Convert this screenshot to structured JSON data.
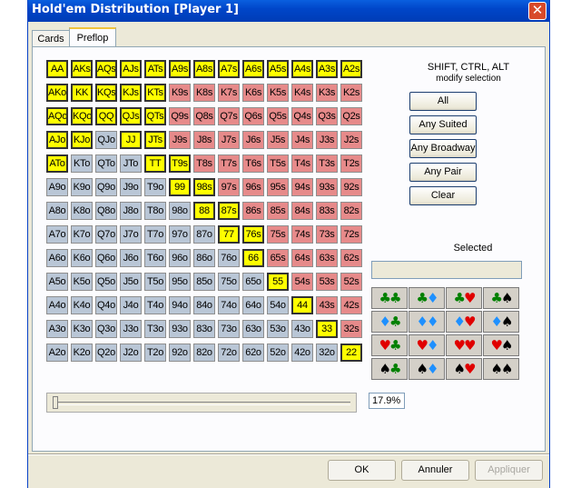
{
  "window": {
    "title": "Hold'em Distribution [Player 1]",
    "close_glyph": "✕"
  },
  "tabs": [
    {
      "label": "Cards"
    },
    {
      "label": "Preflop"
    }
  ],
  "grid": {
    "rows": [
      [
        "AA",
        "AKs",
        "AQs",
        "AJs",
        "ATs",
        "A9s",
        "A8s",
        "A7s",
        "A6s",
        "A5s",
        "A4s",
        "A3s",
        "A2s"
      ],
      [
        "AKo",
        "KK",
        "KQs",
        "KJs",
        "KTs",
        "K9s",
        "K8s",
        "K7s",
        "K6s",
        "K5s",
        "K4s",
        "K3s",
        "K2s"
      ],
      [
        "AQo",
        "KQo",
        "QQ",
        "QJs",
        "QTs",
        "Q9s",
        "Q8s",
        "Q7s",
        "Q6s",
        "Q5s",
        "Q4s",
        "Q3s",
        "Q2s"
      ],
      [
        "AJo",
        "KJo",
        "QJo",
        "JJ",
        "JTs",
        "J9s",
        "J8s",
        "J7s",
        "J6s",
        "J5s",
        "J4s",
        "J3s",
        "J2s"
      ],
      [
        "ATo",
        "KTo",
        "QTo",
        "JTo",
        "TT",
        "T9s",
        "T8s",
        "T7s",
        "T6s",
        "T5s",
        "T4s",
        "T3s",
        "T2s"
      ],
      [
        "A9o",
        "K9o",
        "Q9o",
        "J9o",
        "T9o",
        "99",
        "98s",
        "97s",
        "96s",
        "95s",
        "94s",
        "93s",
        "92s"
      ],
      [
        "A8o",
        "K8o",
        "Q8o",
        "J8o",
        "T8o",
        "98o",
        "88",
        "87s",
        "86s",
        "85s",
        "84s",
        "83s",
        "82s"
      ],
      [
        "A7o",
        "K7o",
        "Q7o",
        "J7o",
        "T7o",
        "97o",
        "87o",
        "77",
        "76s",
        "75s",
        "74s",
        "73s",
        "72s"
      ],
      [
        "A6o",
        "K6o",
        "Q6o",
        "J6o",
        "T6o",
        "96o",
        "86o",
        "76o",
        "66",
        "65s",
        "64s",
        "63s",
        "62s"
      ],
      [
        "A5o",
        "K5o",
        "Q5o",
        "J5o",
        "T5o",
        "95o",
        "85o",
        "75o",
        "65o",
        "55",
        "54s",
        "53s",
        "52s"
      ],
      [
        "A4o",
        "K4o",
        "Q4o",
        "J4o",
        "T4o",
        "94o",
        "84o",
        "74o",
        "64o",
        "54o",
        "44",
        "43s",
        "42s"
      ],
      [
        "A3o",
        "K3o",
        "Q3o",
        "J3o",
        "T3o",
        "93o",
        "83o",
        "73o",
        "63o",
        "53o",
        "43o",
        "33",
        "32s"
      ],
      [
        "A2o",
        "K2o",
        "Q2o",
        "J2o",
        "T2o",
        "92o",
        "82o",
        "72o",
        "62o",
        "52o",
        "42o",
        "32o",
        "22"
      ]
    ],
    "selected": [
      "AA",
      "AKs",
      "AQs",
      "AJs",
      "ATs",
      "A9s",
      "A8s",
      "A7s",
      "A6s",
      "A5s",
      "A4s",
      "A3s",
      "A2s",
      "AKo",
      "KK",
      "KQs",
      "KJs",
      "KTs",
      "AQo",
      "KQo",
      "QQ",
      "QJs",
      "QTs",
      "AJo",
      "KJo",
      "JJ",
      "JTs",
      "ATo",
      "TT",
      "T9s",
      "99",
      "98s",
      "88",
      "87s",
      "77",
      "76s",
      "66",
      "55",
      "44",
      "33",
      "22"
    ],
    "colors": {
      "selected": "#ffff00",
      "suited": "#e68a8a",
      "offsuit": "#b9c6d6"
    }
  },
  "side": {
    "hint_line1": "SHIFT, CTRL, ALT",
    "hint_line2": "modify selection",
    "buttons": [
      "All",
      "Any Suited",
      "Any Broadway",
      "Any Pair",
      "Clear"
    ],
    "selected_label": "Selected",
    "selected_value": ""
  },
  "suit_grid": [
    [
      [
        "c",
        "c"
      ],
      [
        "c",
        "d"
      ],
      [
        "c",
        "h"
      ],
      [
        "c",
        "s"
      ]
    ],
    [
      [
        "d",
        "c"
      ],
      [
        "d",
        "d"
      ],
      [
        "d",
        "h"
      ],
      [
        "d",
        "s"
      ]
    ],
    [
      [
        "h",
        "c"
      ],
      [
        "h",
        "d"
      ],
      [
        "h",
        "h"
      ],
      [
        "h",
        "s"
      ]
    ],
    [
      [
        "s",
        "c"
      ],
      [
        "s",
        "d"
      ],
      [
        "s",
        "h"
      ],
      [
        "s",
        "s"
      ]
    ]
  ],
  "suit_glyphs": {
    "c": "♣",
    "d": "♦",
    "h": "♥",
    "s": "♠"
  },
  "range_percent": "17.9%",
  "footer": {
    "ok": "OK",
    "annuler": "Annuler",
    "appliquer": "Appliquer"
  }
}
